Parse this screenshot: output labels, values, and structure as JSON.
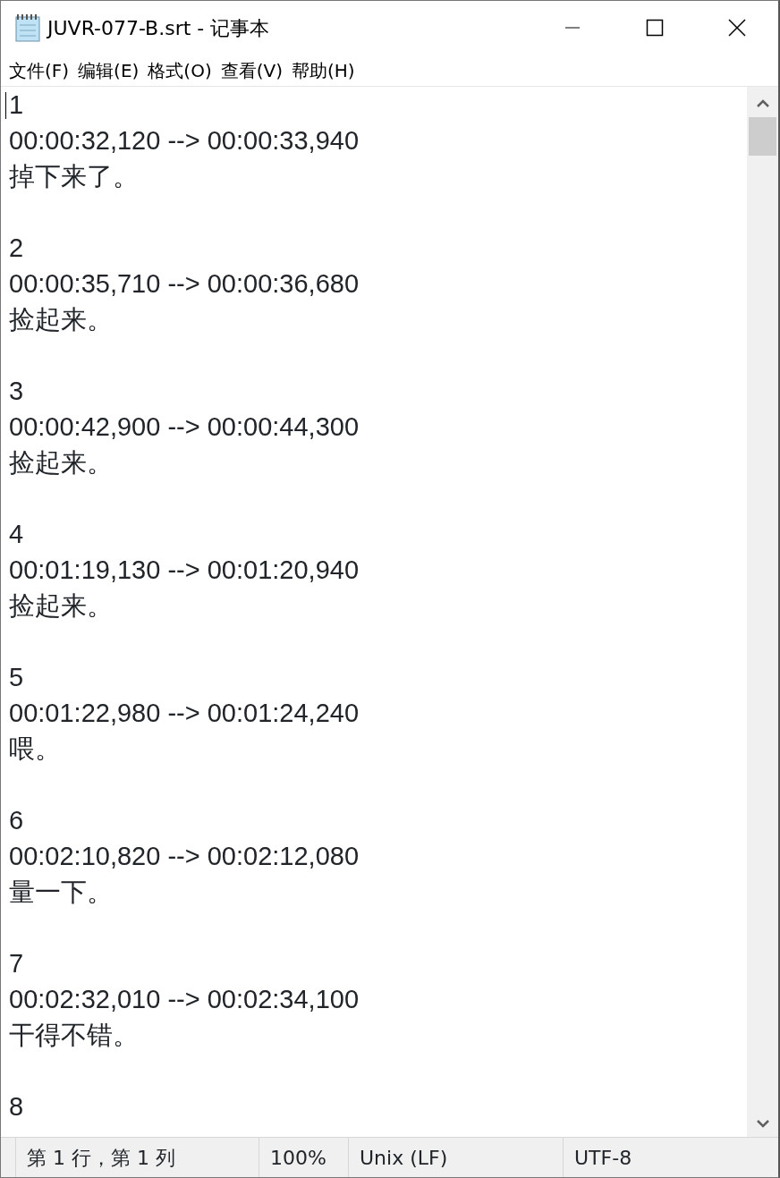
{
  "window": {
    "title": "JUVR-077-B.srt - 记事本"
  },
  "menu": [
    "文件(F)",
    "编辑(E)",
    "格式(O)",
    "查看(V)",
    "帮助(H)"
  ],
  "entries": [
    {
      "index": "1",
      "time": "00:00:32,120 --> 00:00:33,940",
      "text": "掉下来了。"
    },
    {
      "index": "2",
      "time": "00:00:35,710 --> 00:00:36,680",
      "text": "捡起来。"
    },
    {
      "index": "3",
      "time": "00:00:42,900 --> 00:00:44,300",
      "text": "捡起来。"
    },
    {
      "index": "4",
      "time": "00:01:19,130 --> 00:01:20,940",
      "text": "捡起来。"
    },
    {
      "index": "5",
      "time": "00:01:22,980 --> 00:01:24,240",
      "text": "喂。"
    },
    {
      "index": "6",
      "time": "00:02:10,820 --> 00:02:12,080",
      "text": "量一下。"
    },
    {
      "index": "7",
      "time": "00:02:32,010 --> 00:02:34,100",
      "text": "干得不错。"
    },
    {
      "index": "8"
    }
  ],
  "status_bar": {
    "position": "第 1 行，第 1 列",
    "zoom": "100%",
    "line_ending": "Unix (LF)",
    "encoding": "UTF-8"
  }
}
